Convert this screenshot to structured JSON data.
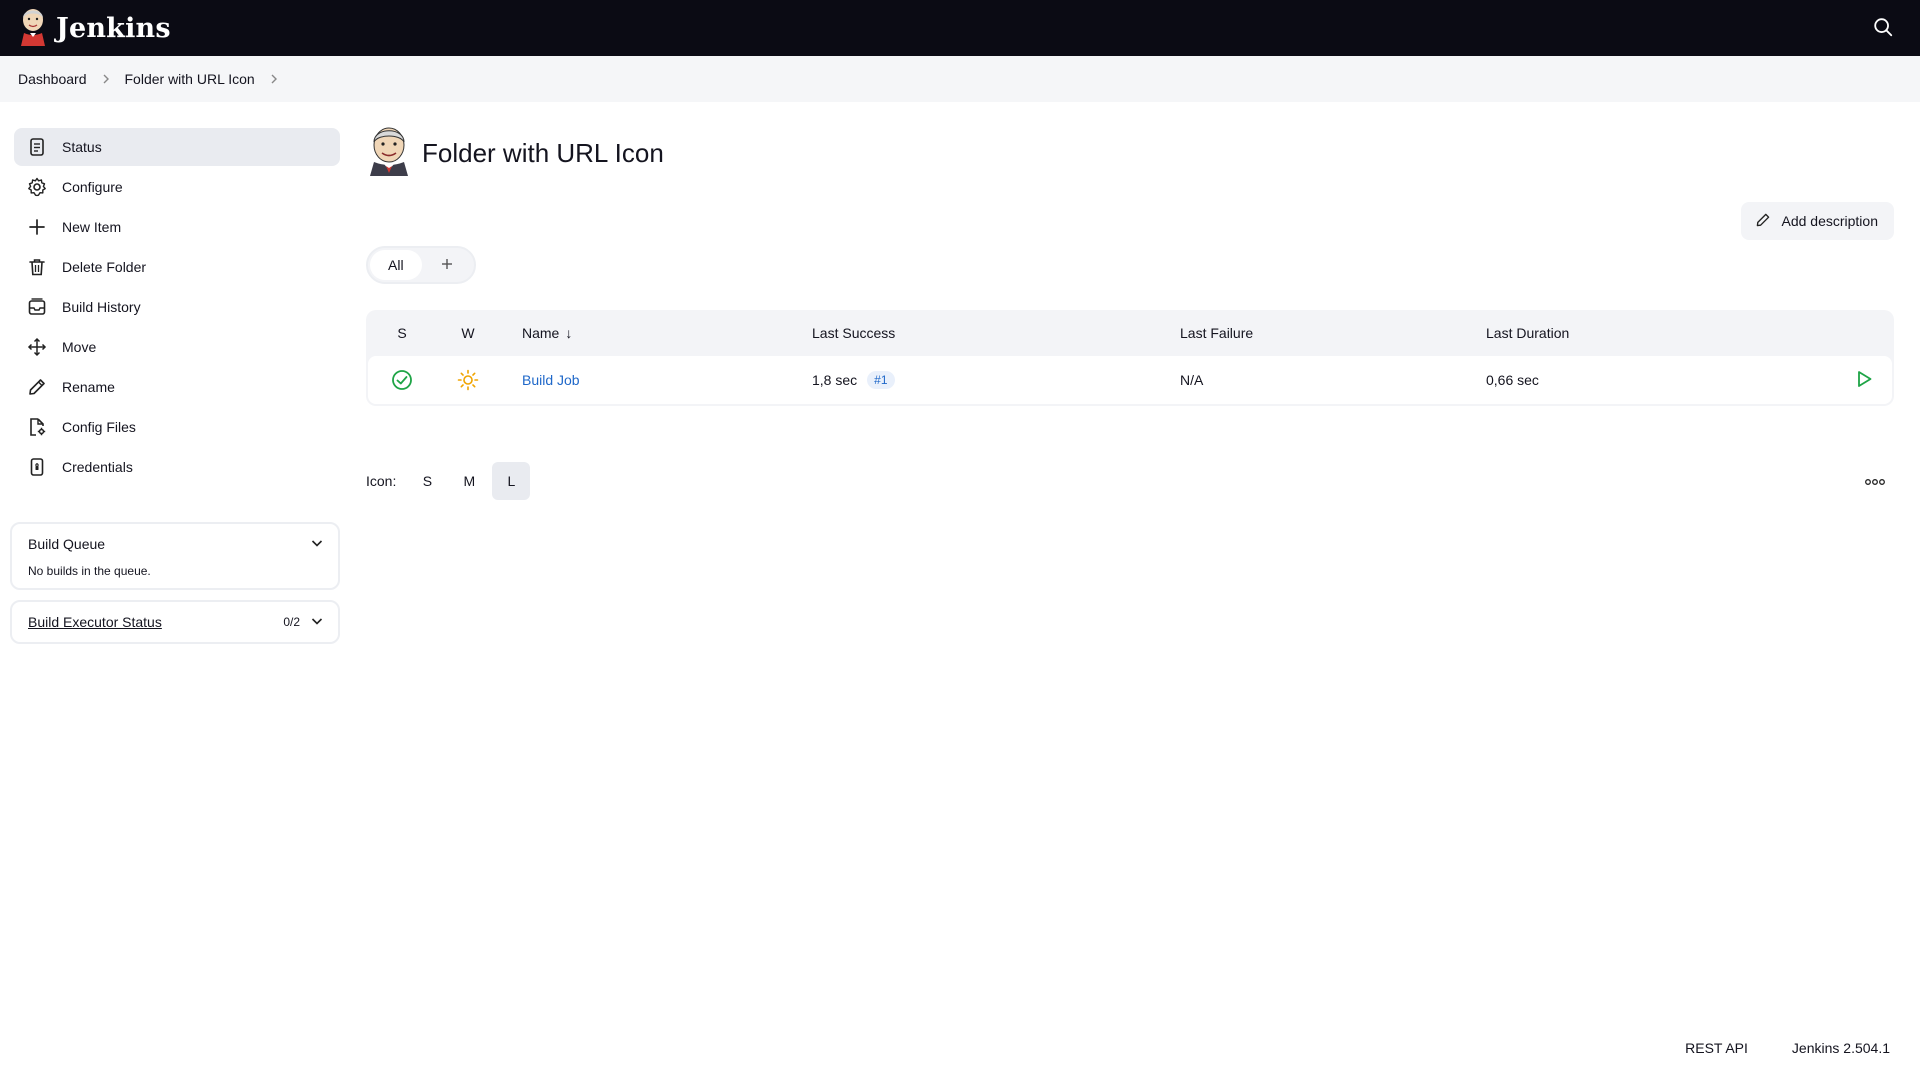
{
  "header": {
    "brand": "Jenkins",
    "search_icon": "search-icon"
  },
  "breadcrumb": {
    "items": [
      "Dashboard",
      "Folder with URL Icon"
    ]
  },
  "sidebar": {
    "items": [
      {
        "label": "Status",
        "icon": "document-icon",
        "active": true
      },
      {
        "label": "Configure",
        "icon": "gear-icon"
      },
      {
        "label": "New Item",
        "icon": "plus-icon"
      },
      {
        "label": "Delete Folder",
        "icon": "trash-icon"
      },
      {
        "label": "Build History",
        "icon": "history-icon"
      },
      {
        "label": "Move",
        "icon": "move-icon"
      },
      {
        "label": "Rename",
        "icon": "pencil-icon"
      },
      {
        "label": "Config Files",
        "icon": "config-file-icon"
      },
      {
        "label": "Credentials",
        "icon": "credentials-icon"
      }
    ],
    "build_queue": {
      "title": "Build Queue",
      "empty_text": "No builds in the queue."
    },
    "executor_status": {
      "title": "Build Executor Status",
      "count": "0/2"
    }
  },
  "main": {
    "title": "Folder with URL Icon",
    "add_description": "Add description",
    "tabs": [
      {
        "label": "All",
        "active": true
      }
    ],
    "table": {
      "headers": {
        "s": "S",
        "w": "W",
        "name": "Name",
        "name_sort": "↓",
        "last_success": "Last Success",
        "last_failure": "Last Failure",
        "last_duration": "Last Duration"
      },
      "rows": [
        {
          "status": "success",
          "weather": "sunny",
          "name": "Build Job",
          "last_success": "1,8 sec",
          "last_success_build": "#1",
          "last_failure": "N/A",
          "last_duration": "0,66 sec"
        }
      ]
    },
    "icon_size": {
      "label": "Icon:",
      "options": [
        "S",
        "M",
        "L"
      ],
      "selected": "L"
    }
  },
  "footer": {
    "rest_api": "REST API",
    "version": "Jenkins 2.504.1"
  },
  "colors": {
    "header_bg": "#0b0b14",
    "link": "#1f68c9",
    "success": "#1ea446",
    "weather": "#f0a400"
  }
}
